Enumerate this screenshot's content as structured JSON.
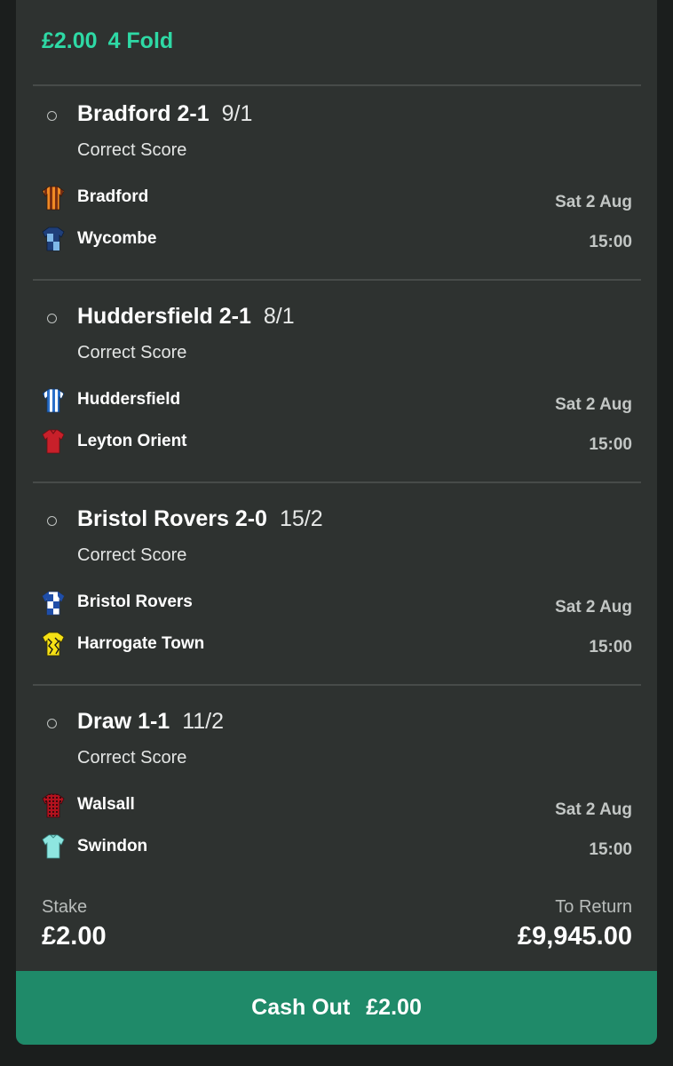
{
  "bet": {
    "stake_header": "£2.00",
    "type": "4 Fold"
  },
  "legs": [
    {
      "selection": "Bradford 2-1",
      "odds": "9/1",
      "market": "Correct Score",
      "home": {
        "name": "Bradford",
        "kit": "bradford-kit-icon"
      },
      "away": {
        "name": "Wycombe",
        "kit": "wycombe-kit-icon"
      },
      "date": "Sat 2 Aug",
      "time": "15:00"
    },
    {
      "selection": "Huddersfield 2-1",
      "odds": "8/1",
      "market": "Correct Score",
      "home": {
        "name": "Huddersfield",
        "kit": "huddersfield-kit-icon"
      },
      "away": {
        "name": "Leyton Orient",
        "kit": "leyton-orient-kit-icon"
      },
      "date": "Sat 2 Aug",
      "time": "15:00"
    },
    {
      "selection": "Bristol Rovers 2-0",
      "odds": "15/2",
      "market": "Correct Score",
      "home": {
        "name": "Bristol Rovers",
        "kit": "bristol-rovers-kit-icon"
      },
      "away": {
        "name": "Harrogate Town",
        "kit": "harrogate-town-kit-icon"
      },
      "date": "Sat 2 Aug",
      "time": "15:00"
    },
    {
      "selection": "Draw 1-1",
      "odds": "11/2",
      "market": "Correct Score",
      "home": {
        "name": "Walsall",
        "kit": "walsall-kit-icon"
      },
      "away": {
        "name": "Swindon",
        "kit": "swindon-kit-icon"
      },
      "date": "Sat 2 Aug",
      "time": "15:00"
    }
  ],
  "summary": {
    "stake_label": "Stake",
    "stake_value": "£2.00",
    "return_label": "To Return",
    "return_value": "£9,945.00"
  },
  "cashout": {
    "label": "Cash Out",
    "amount": "£2.00"
  },
  "colors": {
    "accent": "#2ed9a5",
    "cashout_bg": "#1f8a69",
    "card_bg": "#2e3230"
  }
}
